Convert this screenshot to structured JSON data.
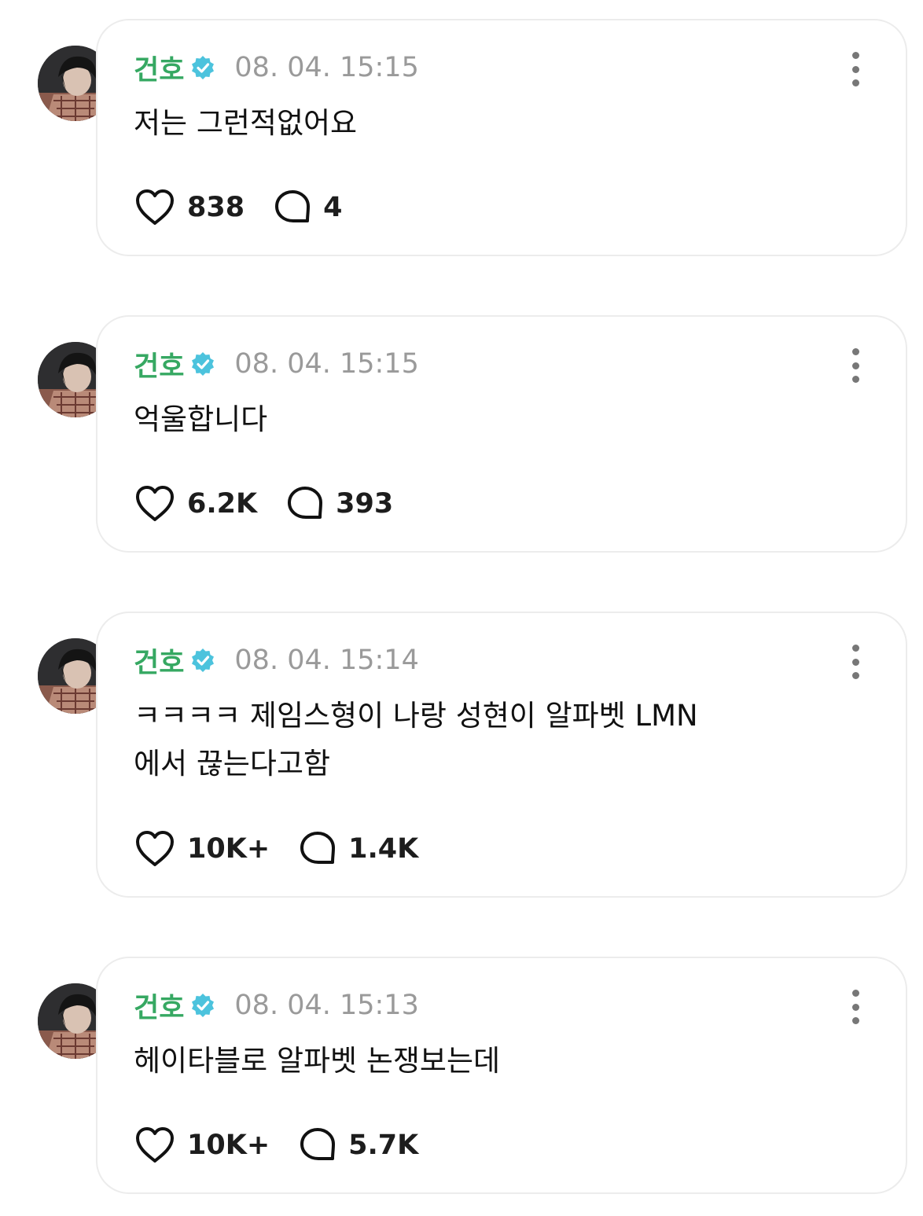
{
  "colors": {
    "author": "#36a862",
    "verified_badge": "#4cc3dd",
    "timestamp": "#9a9a9a",
    "card_border": "#ececec"
  },
  "icons": {
    "verified": "verified-badge-icon",
    "like": "heart-icon",
    "comment": "speech-bubble-icon",
    "more": "more-vertical-icon"
  },
  "posts": [
    {
      "author": "건호",
      "timestamp": "08. 04. 15:15",
      "text": "저는 그런적없어요",
      "likes": "838",
      "comments": "4"
    },
    {
      "author": "건호",
      "timestamp": "08. 04. 15:15",
      "text": "억울합니다",
      "likes": "6.2K",
      "comments": "393"
    },
    {
      "author": "건호",
      "timestamp": "08. 04. 15:14",
      "text": "ㅋㅋㅋㅋ 제임스형이 나랑 성현이 알파벳 LMN\n에서 끊는다고함",
      "likes": "10K+",
      "comments": "1.4K"
    },
    {
      "author": "건호",
      "timestamp": "08. 04. 15:13",
      "text": "헤이타블로 알파벳 논쟁보는데",
      "likes": "10K+",
      "comments": "5.7K"
    }
  ]
}
